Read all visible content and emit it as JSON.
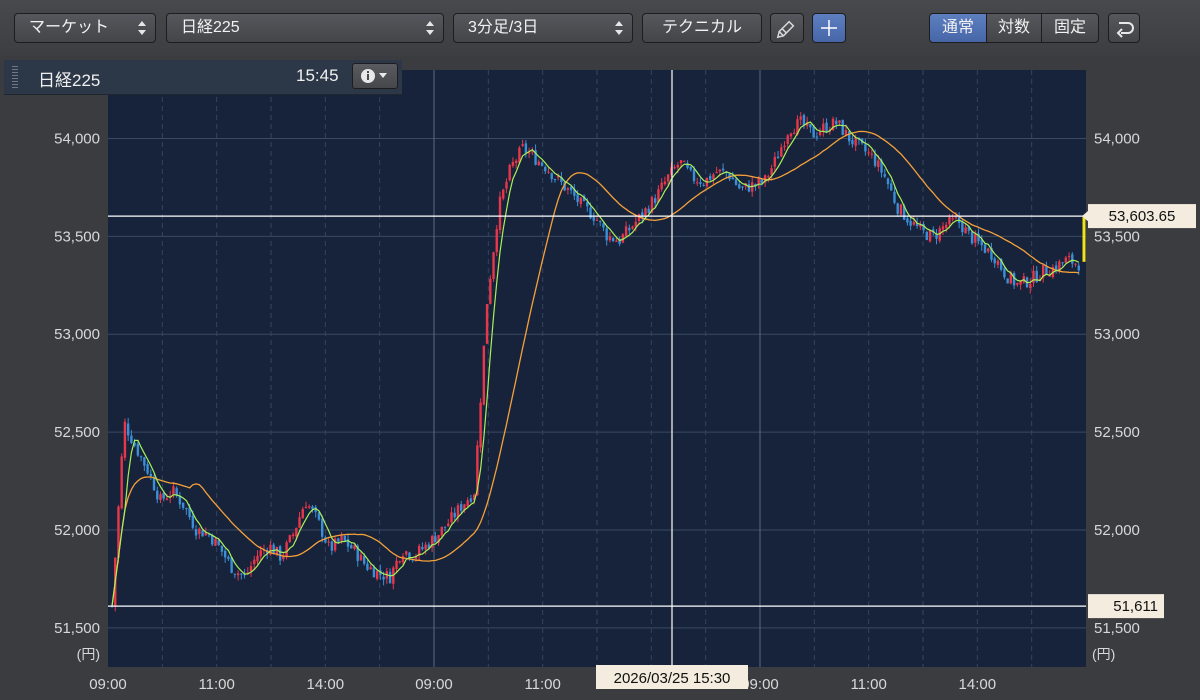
{
  "toolbar": {
    "market_select": "マーケット",
    "symbol_select": "日経225",
    "period_select": "3分足/3日",
    "technical_label": "テクニカル",
    "scale_modes": [
      {
        "label": "通常",
        "active": true
      },
      {
        "label": "対数",
        "active": false
      },
      {
        "label": "固定",
        "active": false
      }
    ]
  },
  "info": {
    "symbol": "日経225",
    "time": "15:45"
  },
  "chart_data": {
    "type": "candlestick",
    "ylim": [
      51300,
      54350
    ],
    "yticks": [
      51500,
      52000,
      52500,
      53000,
      53500,
      54000
    ],
    "ytick_labels": [
      "51,500",
      "52,000",
      "52,500",
      "53,000",
      "53,500",
      "54,000"
    ],
    "y_unit": "(円)",
    "xtick_labels": [
      "09:00",
      "11:00",
      "14:00",
      "09:00",
      "11:00",
      "14:00",
      "09:00",
      "11:00",
      "14:00"
    ],
    "crosshair": {
      "time_label": "2026/03/25 15:30",
      "price_label": "53,603.65",
      "price": 53603.65
    },
    "low_line": {
      "label": "51,611",
      "price": 51611
    },
    "colors": {
      "up": "#e8374b",
      "down": "#3a8fd6",
      "ma_short": "#a8f05a",
      "ma_long": "#f5a13a",
      "background": "#17233a"
    },
    "close_path": [
      51611,
      52550,
      52420,
      52300,
      52150,
      52200,
      52120,
      52000,
      51980,
      51900,
      51800,
      51760,
      51870,
      51920,
      51860,
      51980,
      52150,
      52050,
      51900,
      51950,
      51900,
      51820,
      51780,
      51760,
      51900,
      51870,
      51920,
      51980,
      52050,
      52130,
      52200,
      53150,
      53650,
      53850,
      53950,
      53900,
      53850,
      53780,
      53720,
      53650,
      53600,
      53500,
      53480,
      53550,
      53620,
      53700,
      53800,
      53880,
      53800,
      53780,
      53830,
      53820,
      53740,
      53760,
      53780,
      53900,
      54050,
      54080,
      54020,
      54060,
      54080,
      54000,
      53950,
      53900,
      53800,
      53650,
      53580,
      53520,
      53500,
      53560,
      53580,
      53500,
      53450,
      53400,
      53300,
      53250,
      53280,
      53320,
      53340,
      53380,
      53360
    ]
  }
}
